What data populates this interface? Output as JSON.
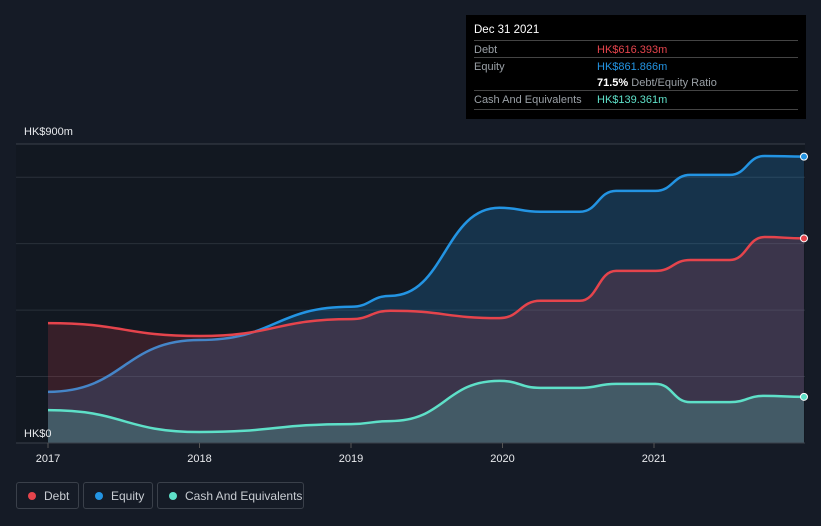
{
  "tooltip": {
    "date": "Dec 31 2021",
    "debt_label": "Debt",
    "debt_value": "HK$616.393m",
    "equity_label": "Equity",
    "equity_value": "HK$861.866m",
    "ratio_value": "71.5%",
    "ratio_label": "Debt/Equity Ratio",
    "cash_label": "Cash And Equivalents",
    "cash_value": "HK$139.361m"
  },
  "legend": [
    {
      "label": "Debt",
      "color": "#e5444c"
    },
    {
      "label": "Equity",
      "color": "#2394e3"
    },
    {
      "label": "Cash And Equivalents",
      "color": "#5ee0c8"
    }
  ],
  "chart_data": {
    "type": "area",
    "x": [
      2017,
      2018,
      2019,
      2019.26,
      2019.98,
      2020.25,
      2020.51,
      2020.75,
      2021.01,
      2021.24,
      2021.5,
      2021.73,
      2021.99
    ],
    "series": [
      {
        "name": "Equity",
        "color": "#2394e3",
        "values": [
          154,
          310,
          410,
          443,
          708,
          696,
          696,
          759,
          759,
          807,
          807,
          864,
          862
        ]
      },
      {
        "name": "Debt",
        "color": "#e5444c",
        "values": [
          361,
          322,
          373,
          398,
          376,
          428,
          428,
          518,
          518,
          551,
          551,
          620,
          616
        ]
      },
      {
        "name": "Cash And Equivalents",
        "color": "#5ee0c8",
        "values": [
          99,
          33,
          57,
          66,
          187,
          166,
          166,
          178,
          178,
          123,
          123,
          142,
          139
        ]
      }
    ],
    "y_tick_labels": [
      "HK$0",
      "HK$900m"
    ],
    "x_tick_labels": [
      "2017",
      "2018",
      "2019",
      "2020",
      "2021"
    ],
    "x_ticks": [
      2017,
      2018,
      2019,
      2020,
      2021
    ],
    "ylim": [
      0,
      900
    ],
    "xlim": [
      2017,
      2021.99
    ]
  }
}
